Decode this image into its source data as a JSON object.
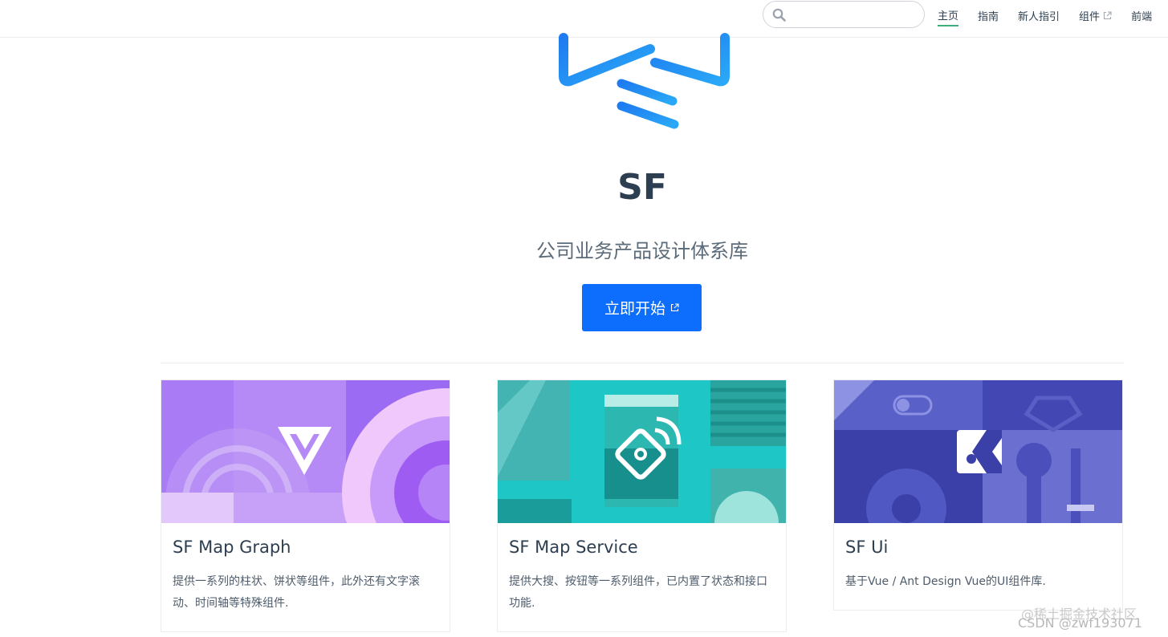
{
  "nav": {
    "search_placeholder": "",
    "links": [
      {
        "label": "主页",
        "active": true,
        "external": false
      },
      {
        "label": "指南",
        "active": false,
        "external": false
      },
      {
        "label": "新人指引",
        "active": false,
        "external": false
      },
      {
        "label": "组件",
        "active": false,
        "external": true
      },
      {
        "label": "前端",
        "active": false,
        "external": false
      }
    ]
  },
  "hero": {
    "title": "SF",
    "description": "公司业务产品设计体系库",
    "cta_label": "立即开始"
  },
  "cards": [
    {
      "title": "SF Map Graph",
      "description": "提供一系列的柱状、饼状等组件，此外还有文字滚动、时间轴等特殊组件."
    },
    {
      "title": "SF Map Service",
      "description": "提供大搜、按钮等一系列组件，已内置了状态和接口功能."
    },
    {
      "title": "SF Ui",
      "description": "基于Vue / Ant Design Vue的UI组件库."
    }
  ],
  "watermark": {
    "line1": "@稀土掘金技术社区",
    "line2": "CSDN @zwf193071"
  },
  "colors": {
    "accent": "#3eaf7c",
    "cta": "#0d6efd",
    "logo_blue": "#1e8cf5"
  }
}
